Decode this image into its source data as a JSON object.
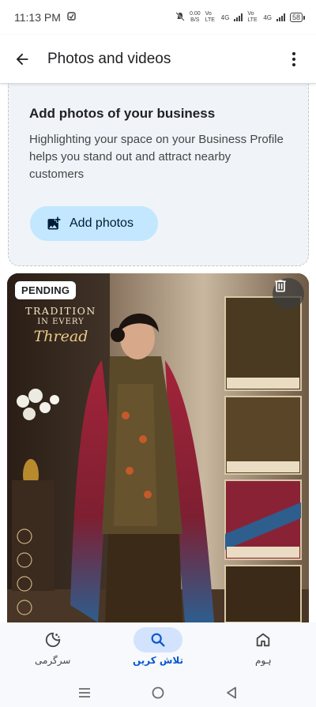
{
  "status_bar": {
    "time": "11:13 PM",
    "net_speed_value": "0.00",
    "net_speed_unit": "B/S",
    "sim1_type": "Vo LTE",
    "sim1_gen": "4G",
    "sim2_type": "Vo LTE",
    "sim2_gen": "4G",
    "battery": "58"
  },
  "app_bar": {
    "title": "Photos and videos"
  },
  "add_card": {
    "heading": "Add photos of your business",
    "description": "Highlighting your space on your Business Profile helps you stand out and attract nearby customers",
    "button_label": "Add photos"
  },
  "photo": {
    "status_badge": "PENDING",
    "poster_line1": "TRADITION",
    "poster_line2": "IN EVERY",
    "poster_line3": "Thread"
  },
  "bottom_nav": {
    "items": [
      {
        "label": "سرگرمی",
        "icon": "activity-icon"
      },
      {
        "label": "تلاش کریں",
        "icon": "search-icon",
        "active": true
      },
      {
        "label": "ہوم",
        "icon": "home-icon"
      }
    ]
  },
  "colors": {
    "accent_pill": "#d3e3fd",
    "add_button_bg": "#c2e7ff",
    "card_bg": "#f0f4f9",
    "active_label": "#0b57d0"
  }
}
